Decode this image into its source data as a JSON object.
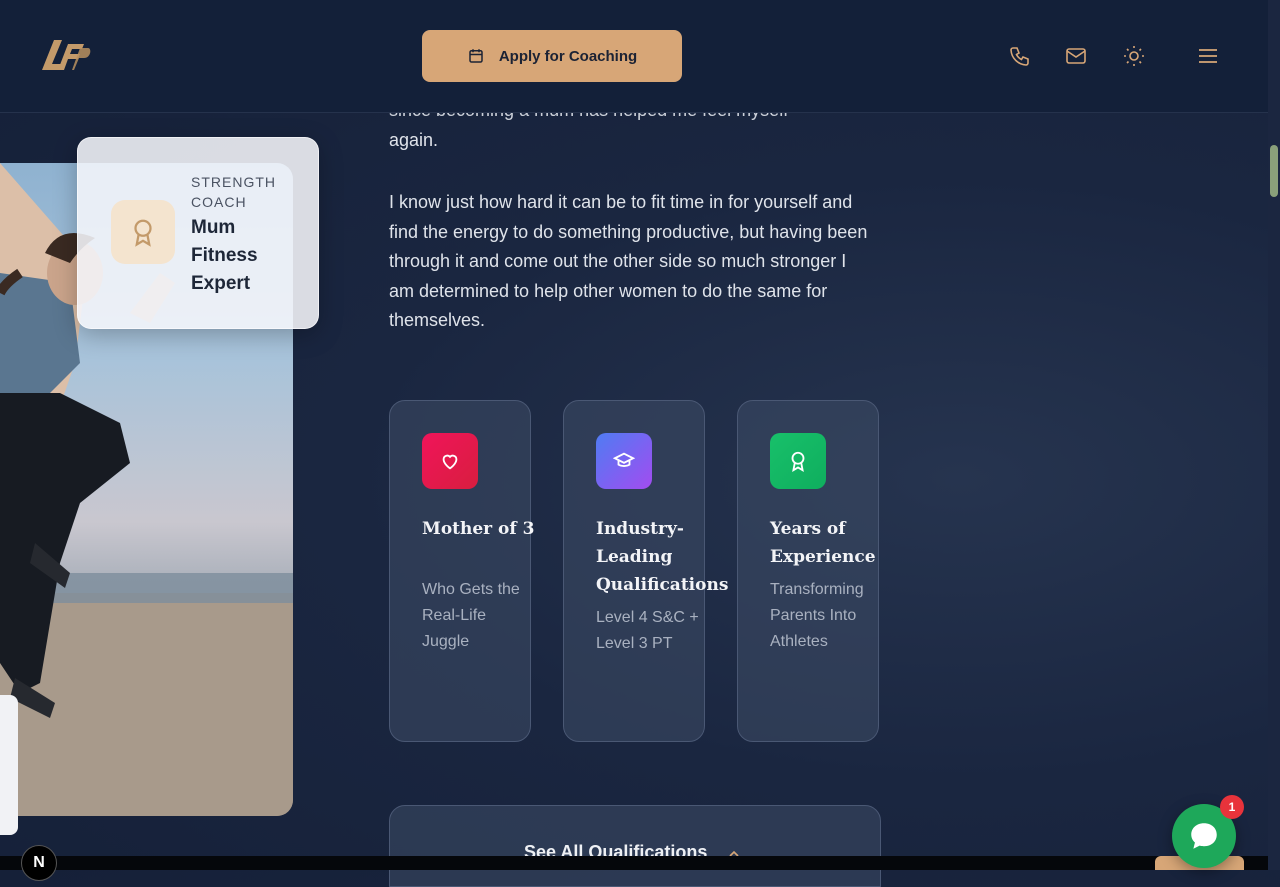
{
  "header": {
    "logo_text": "LFP",
    "apply_label": "Apply for Coaching",
    "icons": [
      "calendar-icon",
      "phone-icon",
      "mail-icon",
      "sun-icon",
      "menu-icon"
    ]
  },
  "coach_card": {
    "subtitle": "STRENGTH COACH",
    "title": "Mum Fitness Expert",
    "icon": "award-icon"
  },
  "intro": {
    "partial_line": "since becoming a mum has helped me feel myself",
    "line_end": "again.",
    "paragraph": "I know just how hard it can be to fit time in for yourself and find the energy to do something productive, but having been through it and come out the other side so much stronger I am determined to help other women to do the same for themselves."
  },
  "stats": [
    {
      "title": "Mother of 3",
      "desc": "Who Gets the Real-Life Juggle",
      "icon": "heart-icon",
      "color": "#e0184e"
    },
    {
      "title": "Industry-Leading Qualifications",
      "desc": "Level 4 S&C + Level 3 PT",
      "icon": "graduation-cap-icon",
      "color": "#7a5cf0"
    },
    {
      "title": "Years of Experience",
      "desc": "Transforming Parents Into Athletes",
      "icon": "award-icon",
      "color": "#1ec46a"
    }
  ],
  "qualifications": {
    "label": "See All Qualifications"
  },
  "chat": {
    "badge": "1"
  },
  "dev_badge": "N",
  "colors": {
    "accent": "#d7a677",
    "bg": "#152038"
  }
}
